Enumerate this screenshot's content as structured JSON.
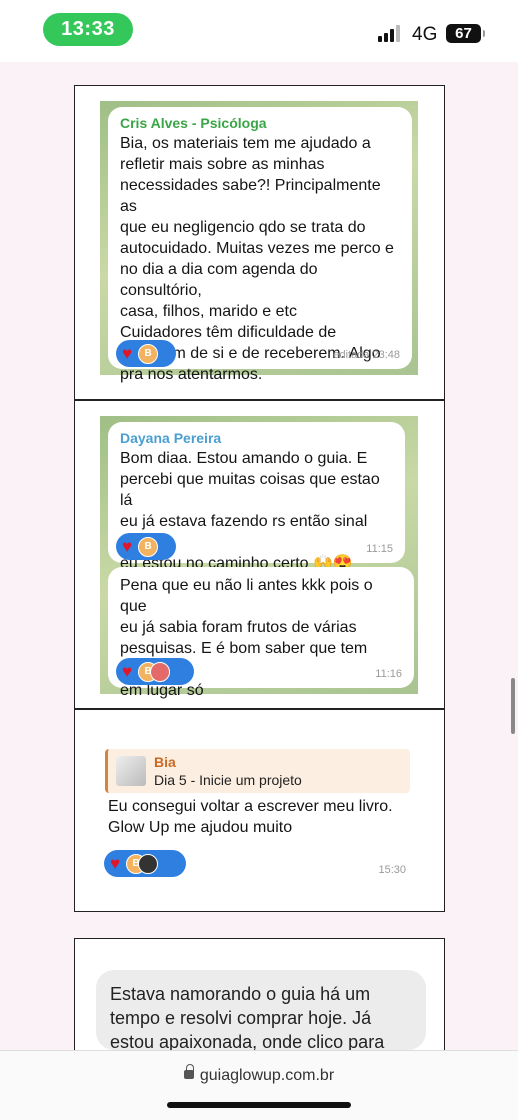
{
  "status_bar": {
    "time": "13:33",
    "network": "4G",
    "battery": "67"
  },
  "cards": [
    {
      "messages": [
        {
          "sender": "Cris Alves - Psicóloga",
          "sender_color": "#3aa547",
          "lines": [
            "Bia, os materiais tem me ajudado a",
            "refletir mais sobre as minhas",
            "necessidades sabe?! Principalmente as",
            "que eu negligencio qdo se trata do",
            "autocuidado. Muitas vezes me perco e",
            "no dia a dia com agenda do consultório,",
            "casa, filhos, marido e etc",
            "Cuidadores têm dificuldade de",
            "cuidarem de si e de receberem. Algo",
            "pra nos atentarmos."
          ],
          "time": "editada 23:48"
        }
      ]
    },
    {
      "messages": [
        {
          "sender": "Dayana Pereira",
          "sender_color": "#4a9fd0",
          "lines": [
            "Bom diaa. Estou amando o guia. E",
            "percebi que muitas coisas que estao lá",
            "eu já estava fazendo rs então sinal que",
            "eu estou no caminho certo 🙌😍"
          ],
          "time": "11:15"
        },
        {
          "lines": [
            "Pena que eu não li antes kkk pois o que",
            "eu já sabia foram frutos de várias",
            "pesquisas. E é bom saber que tem tudo",
            "em lugar só"
          ],
          "time": "11:16"
        }
      ]
    },
    {
      "reply": {
        "name": "Bia",
        "text": "Dia 5 - Inicie um projeto"
      },
      "messages": [
        {
          "lines": [
            "Eu consegui voltar a escrever meu livro.",
            "Glow Up me ajudou muito"
          ],
          "time": "15:30"
        }
      ]
    },
    {
      "messages": [
        {
          "lines": [
            "Estava namorando o guia há um",
            "tempo e resolvi comprar hoje. Já",
            "estou apaixonada, onde clico para"
          ]
        }
      ]
    }
  ],
  "reaction_avatar_initial": "B",
  "browser": {
    "url": "guiaglowup.com.br"
  }
}
